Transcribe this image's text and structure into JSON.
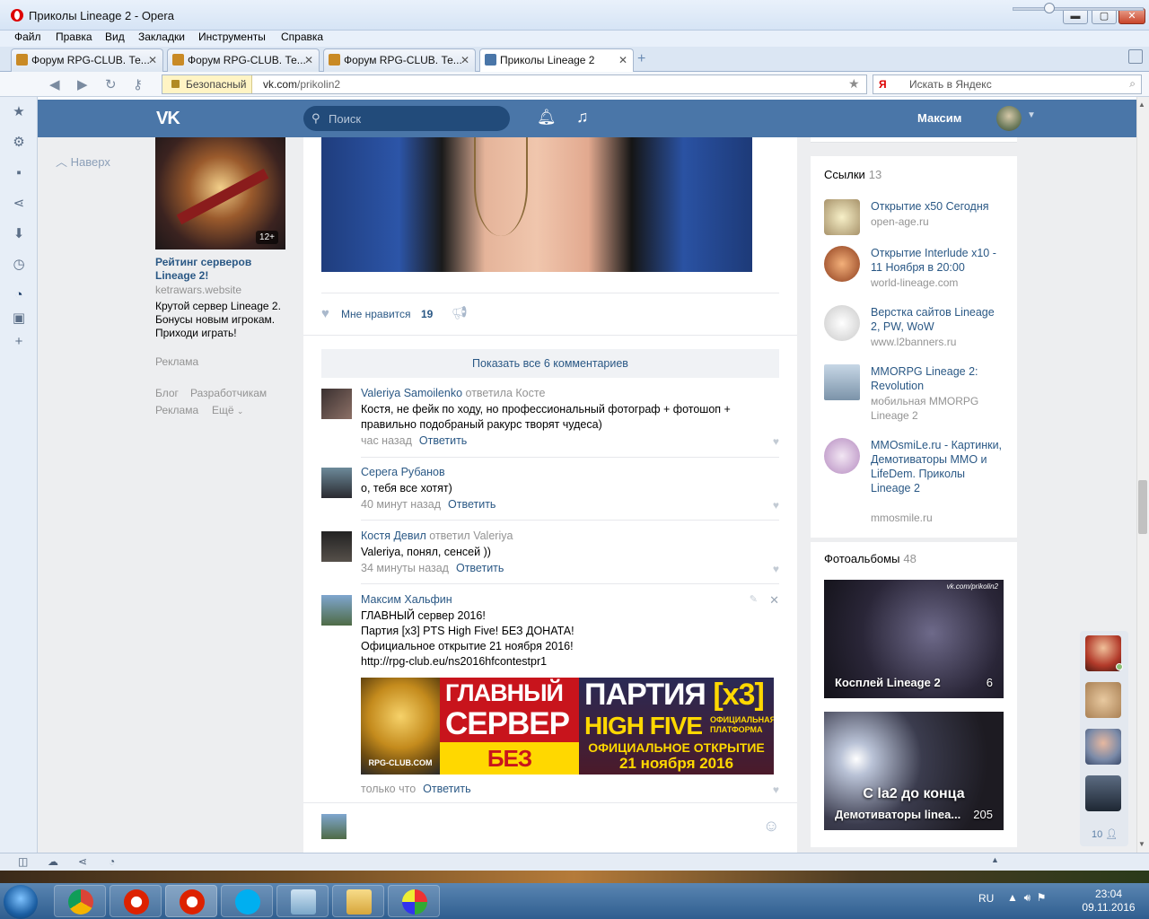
{
  "window": {
    "title": "Приколы Lineage 2 - Opera",
    "min": "▬",
    "max": "▢",
    "close": "✕"
  },
  "menu": [
    "Файл",
    "Правка",
    "Вид",
    "Закладки",
    "Инструменты",
    "Справка"
  ],
  "tabs": [
    {
      "label": "Форум RPG-CLUB. Те...",
      "close": "✕"
    },
    {
      "label": "Форум RPG-CLUB. Те...",
      "close": "✕"
    },
    {
      "label": "Форум RPG-CLUB. Те...",
      "close": "✕"
    },
    {
      "label": "Приколы Lineage 2",
      "close": "✕"
    }
  ],
  "toolbar": {
    "newtab": "+"
  },
  "address": {
    "security": "Безопасный",
    "domain": "vk.com",
    "path": "/prikolin2",
    "search_engine": "Я",
    "search_placeholder": "Искать в Яндекс"
  },
  "vk": {
    "logo": "VK",
    "search_placeholder": "Поиск",
    "user": "Максим",
    "up": "Наверх"
  },
  "ad": {
    "age": "12+",
    "title": "Рейтинг серверов Lineage 2!",
    "domain": "ketrawars.website",
    "text": "Крутой сервер Lineage 2. Бонусы новым игрокам. Приходи играть!",
    "label": "Реклама"
  },
  "footer": {
    "blog": "Блог",
    "dev": "Разработчикам",
    "ads": "Реклама",
    "more": "Ещё"
  },
  "post": {
    "like_label": "Мне нравится",
    "like_count": "19",
    "show_all": "Показать все 6 комментариев",
    "comments": [
      {
        "author": "Valeriya Samoilenko",
        "action": "ответила Косте",
        "text": "Костя, не фейк по ходу, но профессиональный фотограф + фотошоп + правильно подобраный ракурс творят чудеса)",
        "time": "час назад",
        "reply": "Ответить"
      },
      {
        "author": "Серега Рубанов",
        "action": "",
        "text": "о, тебя все хотят)",
        "time": "40 минут назад",
        "reply": "Ответить"
      },
      {
        "author": "Костя Девил",
        "action": "ответил Valeriya",
        "text": "Valeriya, понял, сенсей ))",
        "time": "34 минуты назад",
        "reply": "Ответить"
      },
      {
        "author": "Максим Хальфин",
        "action": "",
        "line1": "ГЛАВНЫЙ сервер 2016!",
        "line2": "Партия [x3] PTS High Five! БЕЗ ДОНАТА!",
        "line3": "Официальное открытие 21 ноября 2016!",
        "link": "http://rpg-club.eu/ns2016hfcontestpr1",
        "time": "только что",
        "reply": "Ответить"
      }
    ],
    "banner": {
      "seal": "RPG-CLUB.COM",
      "main1": "ГЛАВНЫЙ",
      "main2": "СЕРВЕР",
      "main3": "БЕЗ ДОНАТА",
      "party": "ПАРТИЯ",
      "party_x": "[x3]",
      "hf": "HIGH FIVE",
      "hf_small": "ОФИЦИАЛЬНАЯ ПЛАТФОРМА",
      "open1": "ОФИЦИАЛЬНОЕ ОТКРЫТИЕ",
      "open2": "21 ноября 2016"
    }
  },
  "links": {
    "title": "Ссылки",
    "count": "13",
    "items": [
      {
        "title": "Открытие x50 Сегодня",
        "domain": "open-age.ru"
      },
      {
        "title": "Открытие Interlude x10 - 11 Ноября в 20:00",
        "domain": "world-lineage.com"
      },
      {
        "title": "Верстка сайтов Lineage 2, PW, WoW",
        "domain": "www.l2banners.ru"
      },
      {
        "title": "MMORPG Lineage 2: Revolution",
        "domain": "мобильная MMORPG Lineage 2"
      },
      {
        "title": "MMOsmiLe.ru - Картинки, Демотиваторы ММО и LifeDem. Приколы Lineage 2",
        "domain": "mmosmile.ru"
      }
    ]
  },
  "albums": {
    "title": "Фотоальбомы",
    "count": "48",
    "items": [
      {
        "name": "Косплей Lineage 2",
        "count": "6",
        "watermark": "vk.com/prikolin2"
      },
      {
        "name": "Демотиваторы linea...",
        "count": "205",
        "caption": "С la2 до конца"
      }
    ]
  },
  "friends_count": "10",
  "tray": {
    "lang": "RU",
    "time": "23:04",
    "date": "09.11.2016"
  }
}
